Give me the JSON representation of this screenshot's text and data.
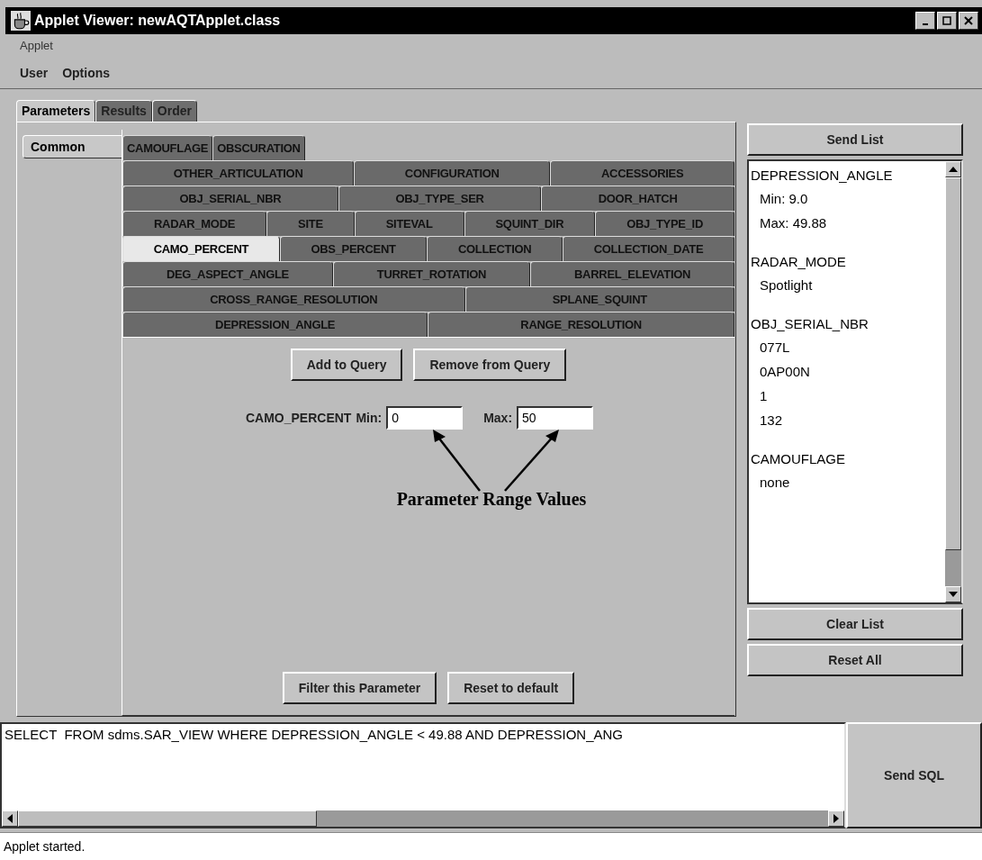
{
  "window": {
    "title": "Applet Viewer: newAQTApplet.class"
  },
  "viewer_menu": [
    "Applet"
  ],
  "applet_menu": [
    "User",
    "Options"
  ],
  "tabs": [
    {
      "label": "Parameters",
      "selected": true
    },
    {
      "label": "Results",
      "selected": false
    },
    {
      "label": "Order",
      "selected": false
    }
  ],
  "side_tabs": [
    {
      "label": "Common",
      "selected": true
    }
  ],
  "parameter_tab_rows": [
    [
      {
        "label": "CAMOUFLAGE",
        "selected": false
      },
      {
        "label": "OBSCURATION",
        "selected": false
      }
    ],
    [
      {
        "label": "OTHER_ARTICULATION",
        "selected": false
      },
      {
        "label": "CONFIGURATION",
        "selected": false
      },
      {
        "label": "ACCESSORIES",
        "selected": false
      }
    ],
    [
      {
        "label": "OBJ_SERIAL_NBR",
        "selected": false
      },
      {
        "label": "OBJ_TYPE_SER",
        "selected": false
      },
      {
        "label": "DOOR_HATCH",
        "selected": false
      }
    ],
    [
      {
        "label": "RADAR_MODE",
        "selected": false
      },
      {
        "label": "SITE",
        "selected": false
      },
      {
        "label": "SITEVAL",
        "selected": false
      },
      {
        "label": "SQUINT_DIR",
        "selected": false
      },
      {
        "label": "OBJ_TYPE_ID",
        "selected": false
      }
    ],
    [
      {
        "label": "CAMO_PERCENT",
        "selected": true
      },
      {
        "label": "OBS_PERCENT",
        "selected": false
      },
      {
        "label": "COLLECTION",
        "selected": false
      },
      {
        "label": "COLLECTION_DATE",
        "selected": false
      }
    ],
    [
      {
        "label": "DEG_ASPECT_ANGLE",
        "selected": false
      },
      {
        "label": "TURRET_ROTATION",
        "selected": false
      },
      {
        "label": "BARREL_ELEVATION",
        "selected": false
      }
    ],
    [
      {
        "label": "CROSS_RANGE_RESOLUTION",
        "selected": false
      },
      {
        "label": "SPLANE_SQUINT",
        "selected": false
      }
    ],
    [
      {
        "label": "DEPRESSION_ANGLE",
        "selected": false
      },
      {
        "label": "RANGE_RESOLUTION",
        "selected": false
      }
    ]
  ],
  "query_buttons": [
    "Add to Query",
    "Remove from Query"
  ],
  "range": {
    "parameter": "CAMO_PERCENT",
    "min_label": "Min:",
    "min_value": "0",
    "max_label": "Max:",
    "max_value": "50"
  },
  "annotation": "Parameter Range Values",
  "filter_buttons": [
    "Filter this Parameter",
    "Reset to default"
  ],
  "send_list_button": "Send List",
  "send_list": [
    {
      "heading": "DEPRESSION_ANGLE",
      "values": [
        "Min: 9.0",
        "Max: 49.88"
      ]
    },
    {
      "heading": "RADAR_MODE",
      "values": [
        "Spotlight"
      ]
    },
    {
      "heading": "OBJ_SERIAL_NBR",
      "values": [
        "077L",
        "0AP00N",
        "1",
        "132"
      ]
    },
    {
      "heading": "CAMOUFLAGE",
      "values": [
        "none"
      ]
    }
  ],
  "list_buttons": [
    "Clear List",
    "Reset All"
  ],
  "sql": {
    "text": "SELECT  FROM sdms.SAR_VIEW WHERE DEPRESSION_ANGLE < 49.88 AND DEPRESSION_ANG",
    "button": "Send SQL"
  },
  "status_bar": "Applet started."
}
